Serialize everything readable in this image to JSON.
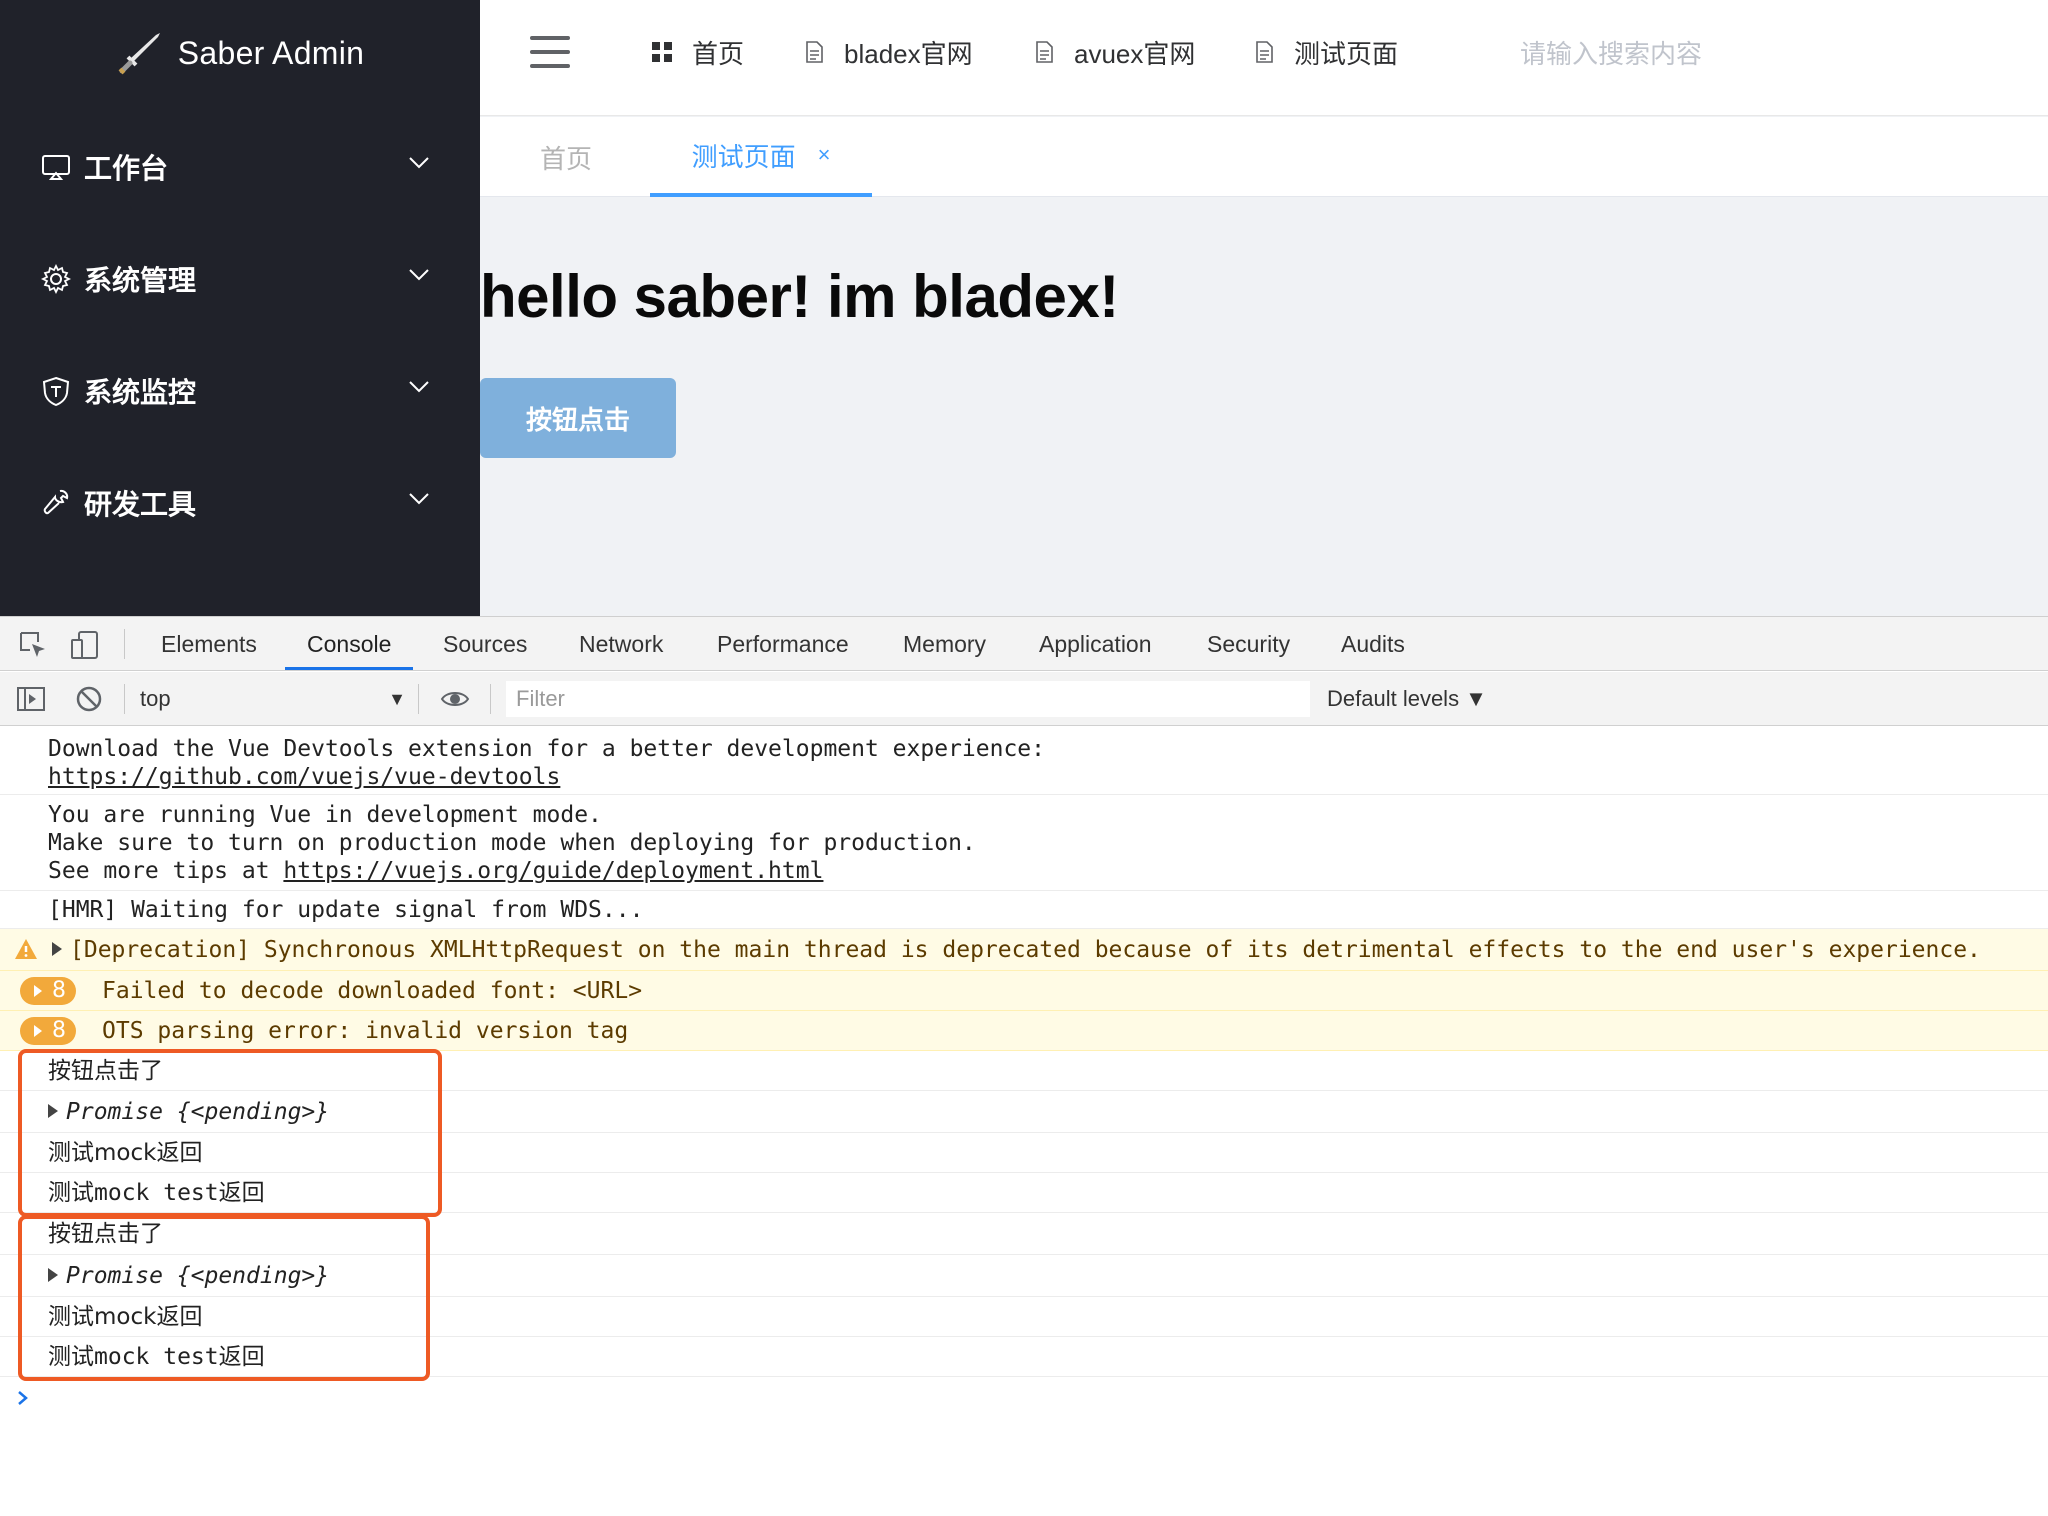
{
  "app": {
    "logo_text": "Saber Admin",
    "sidebar_items": [
      {
        "label": "工作台",
        "icon": "monitor-icon"
      },
      {
        "label": "系统管理",
        "icon": "gear-icon"
      },
      {
        "label": "系统监控",
        "icon": "shield-icon"
      },
      {
        "label": "研发工具",
        "icon": "wrench-icon"
      }
    ],
    "top_nav": [
      {
        "label": "首页",
        "icon": "grid-icon"
      },
      {
        "label": "bladex官网",
        "icon": "document-icon"
      },
      {
        "label": "avuex官网",
        "icon": "document-icon"
      },
      {
        "label": "测试页面",
        "icon": "document-icon"
      }
    ],
    "search_placeholder": "请输入搜索内容",
    "tags": [
      {
        "label": "首页",
        "active": false
      },
      {
        "label": "测试页面",
        "active": true
      }
    ],
    "tag_close": "×",
    "heading": "hello saber! im bladex!",
    "button_label": "按钮点击",
    "accent_color": "#409eff",
    "sidebar_bg": "#20222a"
  },
  "devtools": {
    "tabs": [
      "Elements",
      "Console",
      "Sources",
      "Network",
      "Performance",
      "Memory",
      "Application",
      "Security",
      "Audits"
    ],
    "active_tab": "Console",
    "context": "top",
    "filter_placeholder": "Filter",
    "levels": "Default levels ▼",
    "console": {
      "vue_devtools_line": "Download the Vue Devtools extension for a better development experience:",
      "vue_devtools_link": "https://github.com/vuejs/vue-devtools",
      "dev_mode_line1": "You are running Vue in development mode.",
      "dev_mode_line2": "Make sure to turn on production mode when deploying for production.",
      "dev_mode_line3_prefix": "See more tips at ",
      "dev_mode_link": "https://vuejs.org/guide/deployment.html",
      "hmr_line": "[HMR] Waiting for update signal from WDS...",
      "deprecation_line": "[Deprecation] Synchronous XMLHttpRequest on the main thread is deprecated because of its detrimental effects to the end user's experience.",
      "font_error_count": "8",
      "font_error_line": "Failed to decode downloaded font: <URL>",
      "ots_error_count": "8",
      "ots_error_line": "OTS parsing error: invalid version tag",
      "groups": [
        {
          "clicked": "按钮点击了",
          "promise_name": "Promise",
          "promise_state": "{<pending>}",
          "mock_return": "测试mock返回",
          "mock_test_prefix": "测试mock test",
          "mock_test_suffix": "返回"
        },
        {
          "clicked": "按钮点击了",
          "promise_name": "Promise",
          "promise_state": "{<pending>}",
          "mock_return": "测试mock返回",
          "mock_test_prefix": "测试mock test",
          "mock_test_suffix": "返回"
        }
      ]
    },
    "highlight_color": "#ee5a24",
    "warning_color": "#f2a93b"
  }
}
